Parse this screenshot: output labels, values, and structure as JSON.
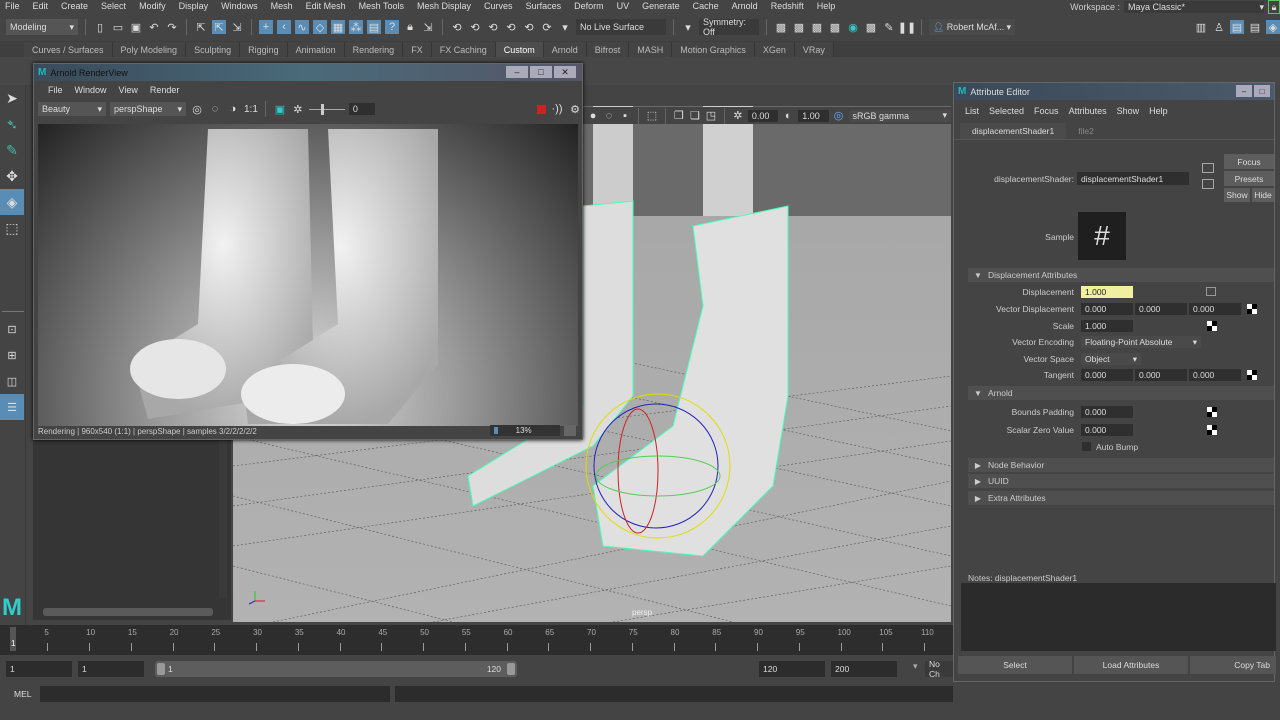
{
  "menubar": {
    "items": [
      "File",
      "Edit",
      "Create",
      "Select",
      "Modify",
      "Display",
      "Windows",
      "Mesh",
      "Edit Mesh",
      "Mesh Tools",
      "Mesh Display",
      "Curves",
      "Surfaces",
      "Deform",
      "UV",
      "Generate",
      "Cache",
      "Arnold",
      "Redshift",
      "Help"
    ],
    "workspace_label": "Workspace :",
    "workspace_value": "Maya Classic*"
  },
  "statusline": {
    "menuset": "Modeling",
    "live_surface": "No Live Surface",
    "symmetry": "Symmetry: Off",
    "user": "Robert McAf..."
  },
  "shelf_tabs": {
    "items": [
      "Curves / Surfaces",
      "Poly Modeling",
      "Sculpting",
      "Rigging",
      "Animation",
      "Rendering",
      "FX",
      "FX Caching",
      "Custom",
      "Arnold",
      "Bifrost",
      "MASH",
      "Motion Graphics",
      "XGen",
      "VRay"
    ],
    "active": "Custom"
  },
  "renderview": {
    "title": "Arnold RenderView",
    "menu": [
      "File",
      "Window",
      "View",
      "Render"
    ],
    "aov": "Beauty",
    "camera": "perspShape",
    "ratio": "1:1",
    "exposure": "0",
    "status": "Rendering | 960x540 (1:1) | perspShape  | samples 3/2/2/2/2/2",
    "progress_label": "13%",
    "progress": 0.13,
    "colors": {
      "stop": "#cc2222"
    }
  },
  "viewport": {
    "exposure": "0.00",
    "gamma": "1.00",
    "colorspace": "sRGB gamma",
    "camera_label": "persp"
  },
  "attribute_editor": {
    "title": "Attribute Editor",
    "menu": [
      "List",
      "Selected",
      "Focus",
      "Attributes",
      "Show",
      "Help"
    ],
    "tabs": [
      "displacementShader1",
      "file2"
    ],
    "active_tab": "displacementShader1",
    "node_label": "displacementShader:",
    "node_value": "displacementShader1",
    "side_buttons": {
      "focus": "Focus",
      "presets": "Presets",
      "show": "Show",
      "hide": "Hide"
    },
    "sample_label": "Sample",
    "sections": {
      "displacement": "Displacement Attributes",
      "arnold": "Arnold",
      "node_behavior": "Node Behavior",
      "uuid": "UUID",
      "extra": "Extra Attributes"
    },
    "attrs": {
      "displacement": {
        "label": "Displacement",
        "value": "1.000"
      },
      "vector_displacement": {
        "label": "Vector Displacement",
        "values": [
          "0.000",
          "0.000",
          "0.000"
        ]
      },
      "scale": {
        "label": "Scale",
        "value": "1.000"
      },
      "vector_encoding": {
        "label": "Vector Encoding",
        "value": "Floating-Point Absolute"
      },
      "vector_space": {
        "label": "Vector Space",
        "value": "Object"
      },
      "tangent": {
        "label": "Tangent",
        "values": [
          "0.000",
          "0.000",
          "0.000"
        ]
      },
      "bounds_padding": {
        "label": "Bounds Padding",
        "value": "0.000"
      },
      "scalar_zero": {
        "label": "Scalar Zero Value",
        "value": "0.000"
      },
      "auto_bump": {
        "label": "Auto Bump",
        "checked": false
      }
    },
    "notes_label": "Notes:  displacementShader1",
    "bottom_buttons": [
      "Select",
      "Load Attributes",
      "Copy Tab"
    ],
    "highlight_color": "#f0f0a0"
  },
  "timeline": {
    "ticks": [
      5,
      10,
      15,
      20,
      25,
      30,
      35,
      40,
      45,
      50,
      55,
      60,
      65,
      70,
      75,
      80,
      85,
      90,
      95,
      100,
      105,
      110
    ],
    "current_frame": "1",
    "start": "1",
    "playback_start": "1",
    "range_start": "1",
    "range_end": "120",
    "playback_end": "120",
    "end": "200",
    "character_set": "No Ch"
  },
  "command_line": {
    "label": "MEL"
  }
}
